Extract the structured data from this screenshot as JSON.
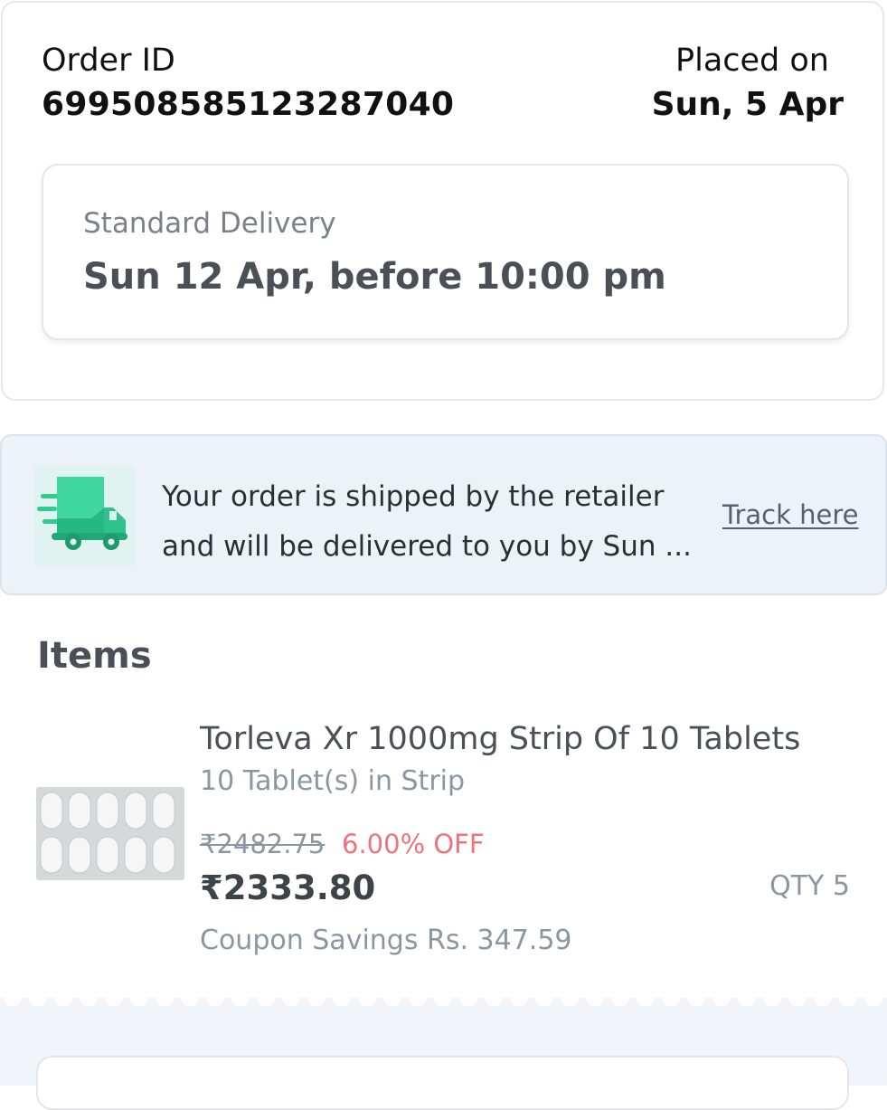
{
  "order": {
    "id_label": "Order ID",
    "id_value": "699508585123287040",
    "placed_label": "Placed on",
    "placed_value": "Sun, 5 Apr"
  },
  "delivery": {
    "type": "Standard Delivery",
    "date": "Sun 12 Apr, before 10:00 pm"
  },
  "shipping_banner": {
    "icon": "delivery-truck-icon",
    "line1": "Your order is shipped by the retailer",
    "line2": "and will be delivered to you by Sun ...",
    "track_label": "Track here"
  },
  "items": {
    "heading": "Items",
    "list": [
      {
        "name": "Torleva Xr 1000mg Strip Of 10 Tablets",
        "pack": "10 Tablet(s) in Strip",
        "mrp": "₹2482.75",
        "discount": "6.00% OFF",
        "price": "₹2333.80",
        "qty": "QTY 5",
        "coupon": "Coupon Savings Rs. 347.59"
      }
    ]
  },
  "colors": {
    "accent_green": "#2ecc8f",
    "discount_red": "#f0727a",
    "banner_bg": "#edf1f8"
  }
}
